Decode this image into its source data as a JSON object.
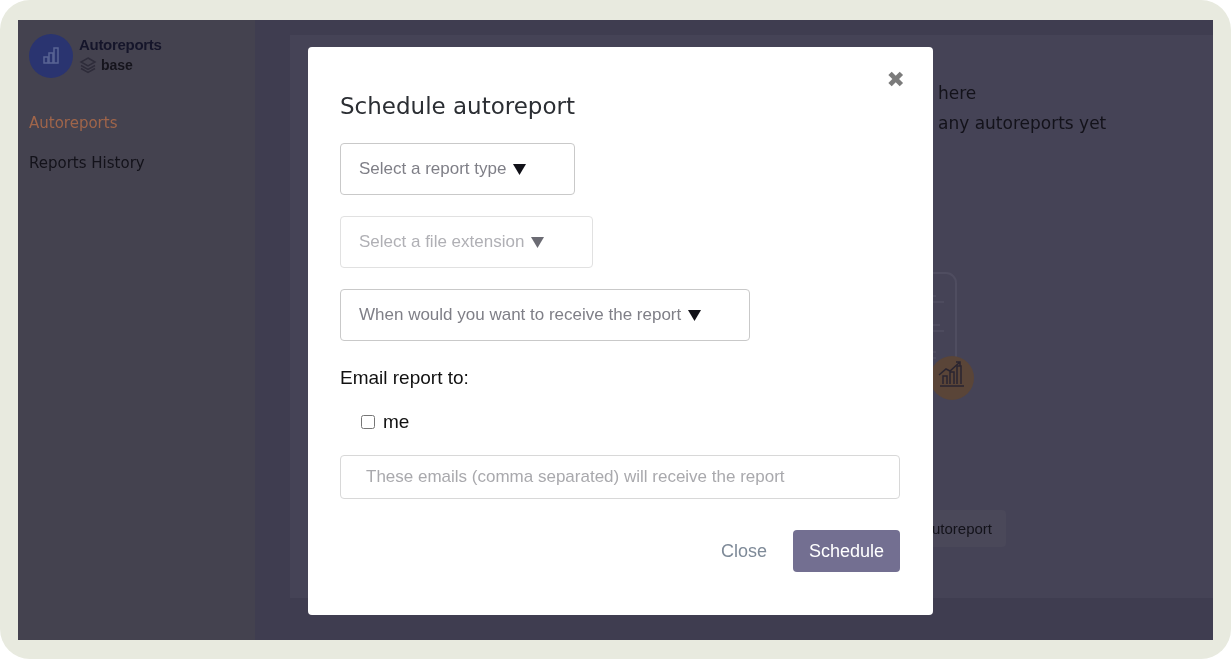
{
  "sidebar": {
    "app_name": "Autoreports",
    "workspace": "base",
    "items": [
      {
        "label": "Autoreports",
        "selected": true
      },
      {
        "label": "Reports History",
        "selected": false
      }
    ]
  },
  "main": {
    "heading": "here",
    "subheading": "any autoreports yet",
    "button": "utoreport"
  },
  "modal": {
    "title": "Schedule autoreport",
    "close": "✖",
    "selects": [
      {
        "placeholder": "Select a report type",
        "disabled": false
      },
      {
        "placeholder": "Select a file extension",
        "disabled": true
      },
      {
        "placeholder": "When would you want to receive the report",
        "disabled": false
      }
    ],
    "email_label": "Email report to:",
    "me": {
      "label": "me",
      "checked": false
    },
    "emails": {
      "placeholder": "These emails (comma separated) will receive the report"
    },
    "buttons": [
      {
        "label": "Close",
        "kind": "link"
      },
      {
        "label": "Schedule",
        "kind": "primary"
      }
    ]
  }
}
